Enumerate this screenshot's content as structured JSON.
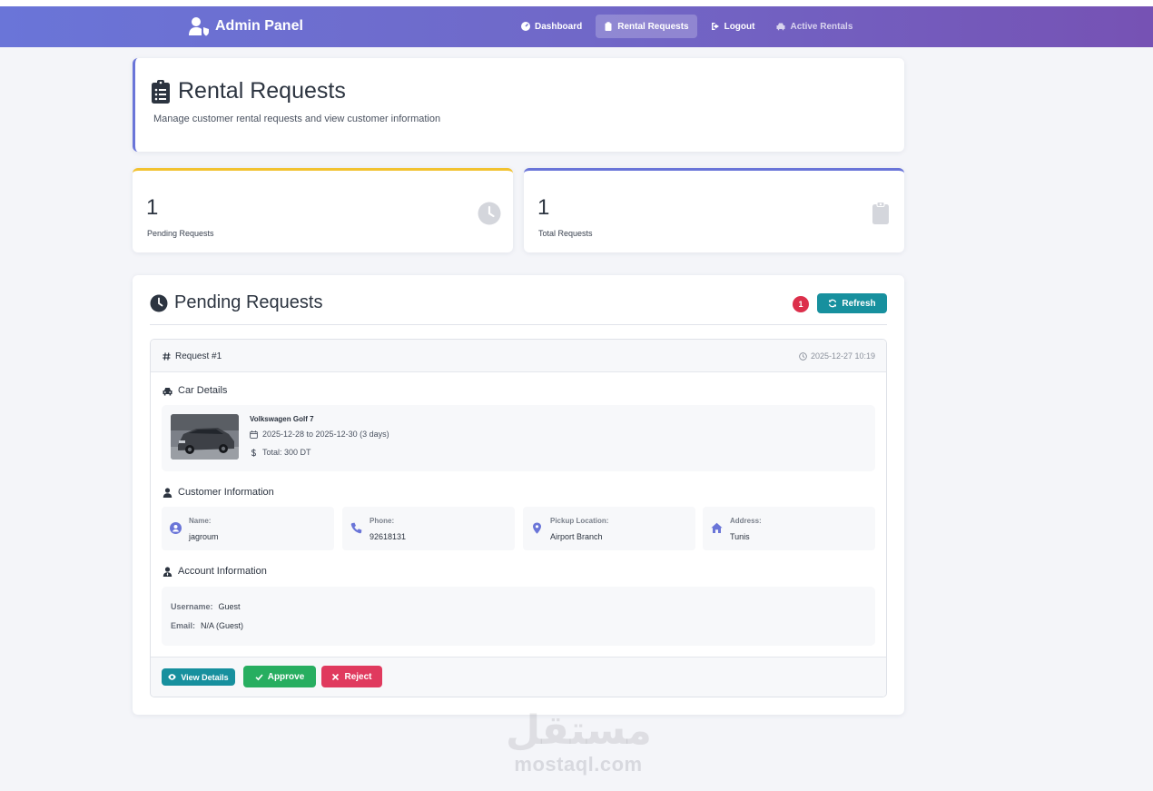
{
  "navbar": {
    "brand": "Admin Panel",
    "items": [
      {
        "label": "Dashboard",
        "icon": "gauge-icon",
        "active": false
      },
      {
        "label": "Rental Requests",
        "icon": "clipboard-icon",
        "active": true
      },
      {
        "label": "Logout",
        "icon": "logout-icon",
        "active": false
      },
      {
        "label": "Active Rentals",
        "icon": "car-icon",
        "active": false
      }
    ]
  },
  "header": {
    "title": "Rental Requests",
    "subtitle": "Manage customer rental requests and view customer information"
  },
  "stats": {
    "pending": {
      "value": "1",
      "label": "Pending Requests",
      "color": "#f2c230"
    },
    "total": {
      "value": "1",
      "label": "Total Requests",
      "color": "#6a75d8"
    }
  },
  "pending": {
    "title": "Pending Requests",
    "count": "1",
    "refresh_label": "Refresh"
  },
  "request": {
    "id_label": "Request #1",
    "timestamp": "2025-12-27 10:19",
    "car_section": "Car Details",
    "car_name": "Volkswagen Golf 7",
    "dates": "2025-12-28 to 2025-12-30 (3 days)",
    "total": "Total: 300 DT",
    "customer_section": "Customer Information",
    "customer": {
      "name_label": "Name:",
      "name": "jagroum",
      "phone_label": "Phone:",
      "phone": "92618131",
      "pickup_label": "Pickup Location:",
      "pickup": "Airport Branch",
      "address_label": "Address:",
      "address": "Tunis"
    },
    "account_section": "Account Information",
    "account": {
      "username_label": "Username:",
      "username": "Guest",
      "email_label": "Email:",
      "email": "N/A (Guest)"
    },
    "actions": {
      "view": "View Details",
      "approve": "Approve",
      "reject": "Reject"
    }
  },
  "watermark": {
    "arabic": "مستقل",
    "latin": "mostaql.com"
  },
  "colors": {
    "accent": "#6a75d8",
    "teal": "#17909e",
    "success": "#27ae60",
    "danger": "#e03a5e",
    "warning": "#f2c230"
  }
}
